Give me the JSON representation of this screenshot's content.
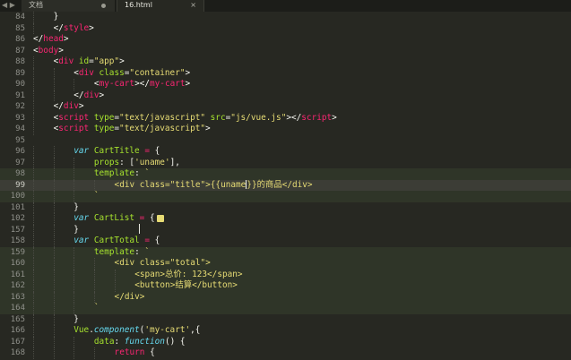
{
  "tabs": [
    {
      "label": "文档",
      "state": "modified"
    },
    {
      "label": "16.html",
      "state": "active"
    }
  ],
  "nav": {
    "back": "◀",
    "forward": "▶"
  },
  "tab_close": "×",
  "colors": {
    "background": "#272822",
    "tag": "#f92672",
    "attribute": "#a6e22e",
    "string": "#e6db74",
    "keyword": "#66d9ef"
  },
  "lines": [
    {
      "num": "84",
      "indent": 1,
      "segments": [
        [
          "pl",
          "}"
        ]
      ]
    },
    {
      "num": "85",
      "indent": 1,
      "segments": [
        [
          "pl",
          "</"
        ],
        [
          "tg",
          "style"
        ],
        [
          "pl",
          ">"
        ]
      ]
    },
    {
      "num": "86",
      "indent": 0,
      "segments": [
        [
          "pl",
          "</"
        ],
        [
          "tg",
          "head"
        ],
        [
          "pl",
          ">"
        ]
      ]
    },
    {
      "num": "87",
      "indent": 0,
      "segments": [
        [
          "pl",
          "<"
        ],
        [
          "tg",
          "body"
        ],
        [
          "pl",
          ">"
        ]
      ]
    },
    {
      "num": "88",
      "indent": 1,
      "segments": [
        [
          "pl",
          "<"
        ],
        [
          "tg",
          "div"
        ],
        [
          "pl",
          " "
        ],
        [
          "at",
          "id"
        ],
        [
          "pl",
          "="
        ],
        [
          "st",
          "\"app\""
        ],
        [
          "pl",
          ">"
        ]
      ]
    },
    {
      "num": "89",
      "indent": 2,
      "segments": [
        [
          "pl",
          "<"
        ],
        [
          "tg",
          "div"
        ],
        [
          "pl",
          " "
        ],
        [
          "at",
          "class"
        ],
        [
          "pl",
          "="
        ],
        [
          "st",
          "\"container\""
        ],
        [
          "pl",
          ">"
        ]
      ]
    },
    {
      "num": "90",
      "indent": 3,
      "segments": [
        [
          "pl",
          "<"
        ],
        [
          "tg",
          "my-cart"
        ],
        [
          "pl",
          "></"
        ],
        [
          "tg",
          "my-cart"
        ],
        [
          "pl",
          ">"
        ]
      ]
    },
    {
      "num": "91",
      "indent": 2,
      "segments": [
        [
          "pl",
          "</"
        ],
        [
          "tg",
          "div"
        ],
        [
          "pl",
          ">"
        ]
      ]
    },
    {
      "num": "92",
      "indent": 1,
      "segments": [
        [
          "pl",
          "</"
        ],
        [
          "tg",
          "div"
        ],
        [
          "pl",
          ">"
        ]
      ]
    },
    {
      "num": "93",
      "indent": 1,
      "segments": [
        [
          "pl",
          "<"
        ],
        [
          "tg",
          "script"
        ],
        [
          "pl",
          " "
        ],
        [
          "at",
          "type"
        ],
        [
          "pl",
          "="
        ],
        [
          "st",
          "\"text/javascript\""
        ],
        [
          "pl",
          " "
        ],
        [
          "at",
          "src"
        ],
        [
          "pl",
          "="
        ],
        [
          "st",
          "\"js/vue.js\""
        ],
        [
          "pl",
          "></"
        ],
        [
          "tg",
          "script"
        ],
        [
          "pl",
          ">"
        ]
      ]
    },
    {
      "num": "94",
      "indent": 1,
      "segments": [
        [
          "pl",
          "<"
        ],
        [
          "tg",
          "script"
        ],
        [
          "pl",
          " "
        ],
        [
          "at",
          "type"
        ],
        [
          "pl",
          "="
        ],
        [
          "st",
          "\"text/javascript\""
        ],
        [
          "pl",
          ">"
        ]
      ]
    },
    {
      "num": "95",
      "indent": 0,
      "segments": []
    },
    {
      "num": "96",
      "indent": 2,
      "segments": [
        [
          "kw",
          "var"
        ],
        [
          "pl",
          " "
        ],
        [
          "vn",
          "CartTitle"
        ],
        [
          "pl",
          " "
        ],
        [
          "op",
          "="
        ],
        [
          "pl",
          " {"
        ]
      ]
    },
    {
      "num": "97",
      "indent": 3,
      "segments": [
        [
          "vn",
          "props"
        ],
        [
          "pl",
          ": ["
        ],
        [
          "st",
          "'uname'"
        ],
        [
          "pl",
          "],"
        ]
      ]
    },
    {
      "num": "98",
      "indent": 3,
      "hl": true,
      "segments": [
        [
          "vn",
          "template"
        ],
        [
          "pl",
          ": "
        ],
        [
          "st",
          "`"
        ]
      ]
    },
    {
      "num": "99",
      "indent": 4,
      "hl": true,
      "cur": true,
      "segments": [
        [
          "st",
          "<div class=\"title\">{{uname"
        ],
        [
          "caret",
          ""
        ],
        [
          "st",
          "}}的商品</div>"
        ]
      ]
    },
    {
      "num": "100",
      "indent": 3,
      "hl": true,
      "segments": [
        [
          "st",
          "`"
        ]
      ]
    },
    {
      "num": "101",
      "indent": 2,
      "segments": [
        [
          "pl",
          "}"
        ]
      ]
    },
    {
      "num": "102",
      "indent": 2,
      "segments": [
        [
          "kw",
          "var"
        ],
        [
          "pl",
          " "
        ],
        [
          "vn",
          "CartList"
        ],
        [
          "pl",
          " "
        ],
        [
          "op",
          "="
        ],
        [
          "pl",
          " {"
        ],
        [
          "fold",
          ""
        ]
      ]
    },
    {
      "num": "157",
      "indent": 2,
      "segments": [
        [
          "pl",
          "}"
        ]
      ]
    },
    {
      "num": "158",
      "indent": 2,
      "segments": [
        [
          "kw",
          "var"
        ],
        [
          "pl",
          " "
        ],
        [
          "vn",
          "CartTotal"
        ],
        [
          "pl",
          " "
        ],
        [
          "op",
          "="
        ],
        [
          "pl",
          " {"
        ]
      ]
    },
    {
      "num": "159",
      "indent": 3,
      "hl": true,
      "segments": [
        [
          "vn",
          "template"
        ],
        [
          "pl",
          ": "
        ],
        [
          "st",
          "`"
        ]
      ]
    },
    {
      "num": "160",
      "indent": 4,
      "hl": true,
      "segments": [
        [
          "st",
          "<div class=\"total\">"
        ]
      ]
    },
    {
      "num": "161",
      "indent": 5,
      "hl": true,
      "segments": [
        [
          "st",
          "<span>总价: 123</span>"
        ]
      ]
    },
    {
      "num": "162",
      "indent": 5,
      "hl": true,
      "segments": [
        [
          "st",
          "<button>结算</button>"
        ]
      ]
    },
    {
      "num": "163",
      "indent": 4,
      "hl": true,
      "segments": [
        [
          "st",
          "</div>"
        ]
      ]
    },
    {
      "num": "164",
      "indent": 3,
      "hl": true,
      "segments": [
        [
          "st",
          "`"
        ]
      ]
    },
    {
      "num": "165",
      "indent": 2,
      "segments": [
        [
          "pl",
          "}"
        ]
      ]
    },
    {
      "num": "166",
      "indent": 2,
      "segments": [
        [
          "vn",
          "Vue"
        ],
        [
          "pl",
          "."
        ],
        [
          "kw",
          "component"
        ],
        [
          "pl",
          "("
        ],
        [
          "st",
          "'my-cart'"
        ],
        [
          "pl",
          ",{"
        ]
      ]
    },
    {
      "num": "167",
      "indent": 3,
      "segments": [
        [
          "vn",
          "data"
        ],
        [
          "pl",
          ": "
        ],
        [
          "kw",
          "function"
        ],
        [
          "pl",
          "() {"
        ]
      ]
    },
    {
      "num": "168",
      "indent": 4,
      "segments": [
        [
          "tg",
          "return"
        ],
        [
          "pl",
          " {"
        ]
      ]
    }
  ]
}
